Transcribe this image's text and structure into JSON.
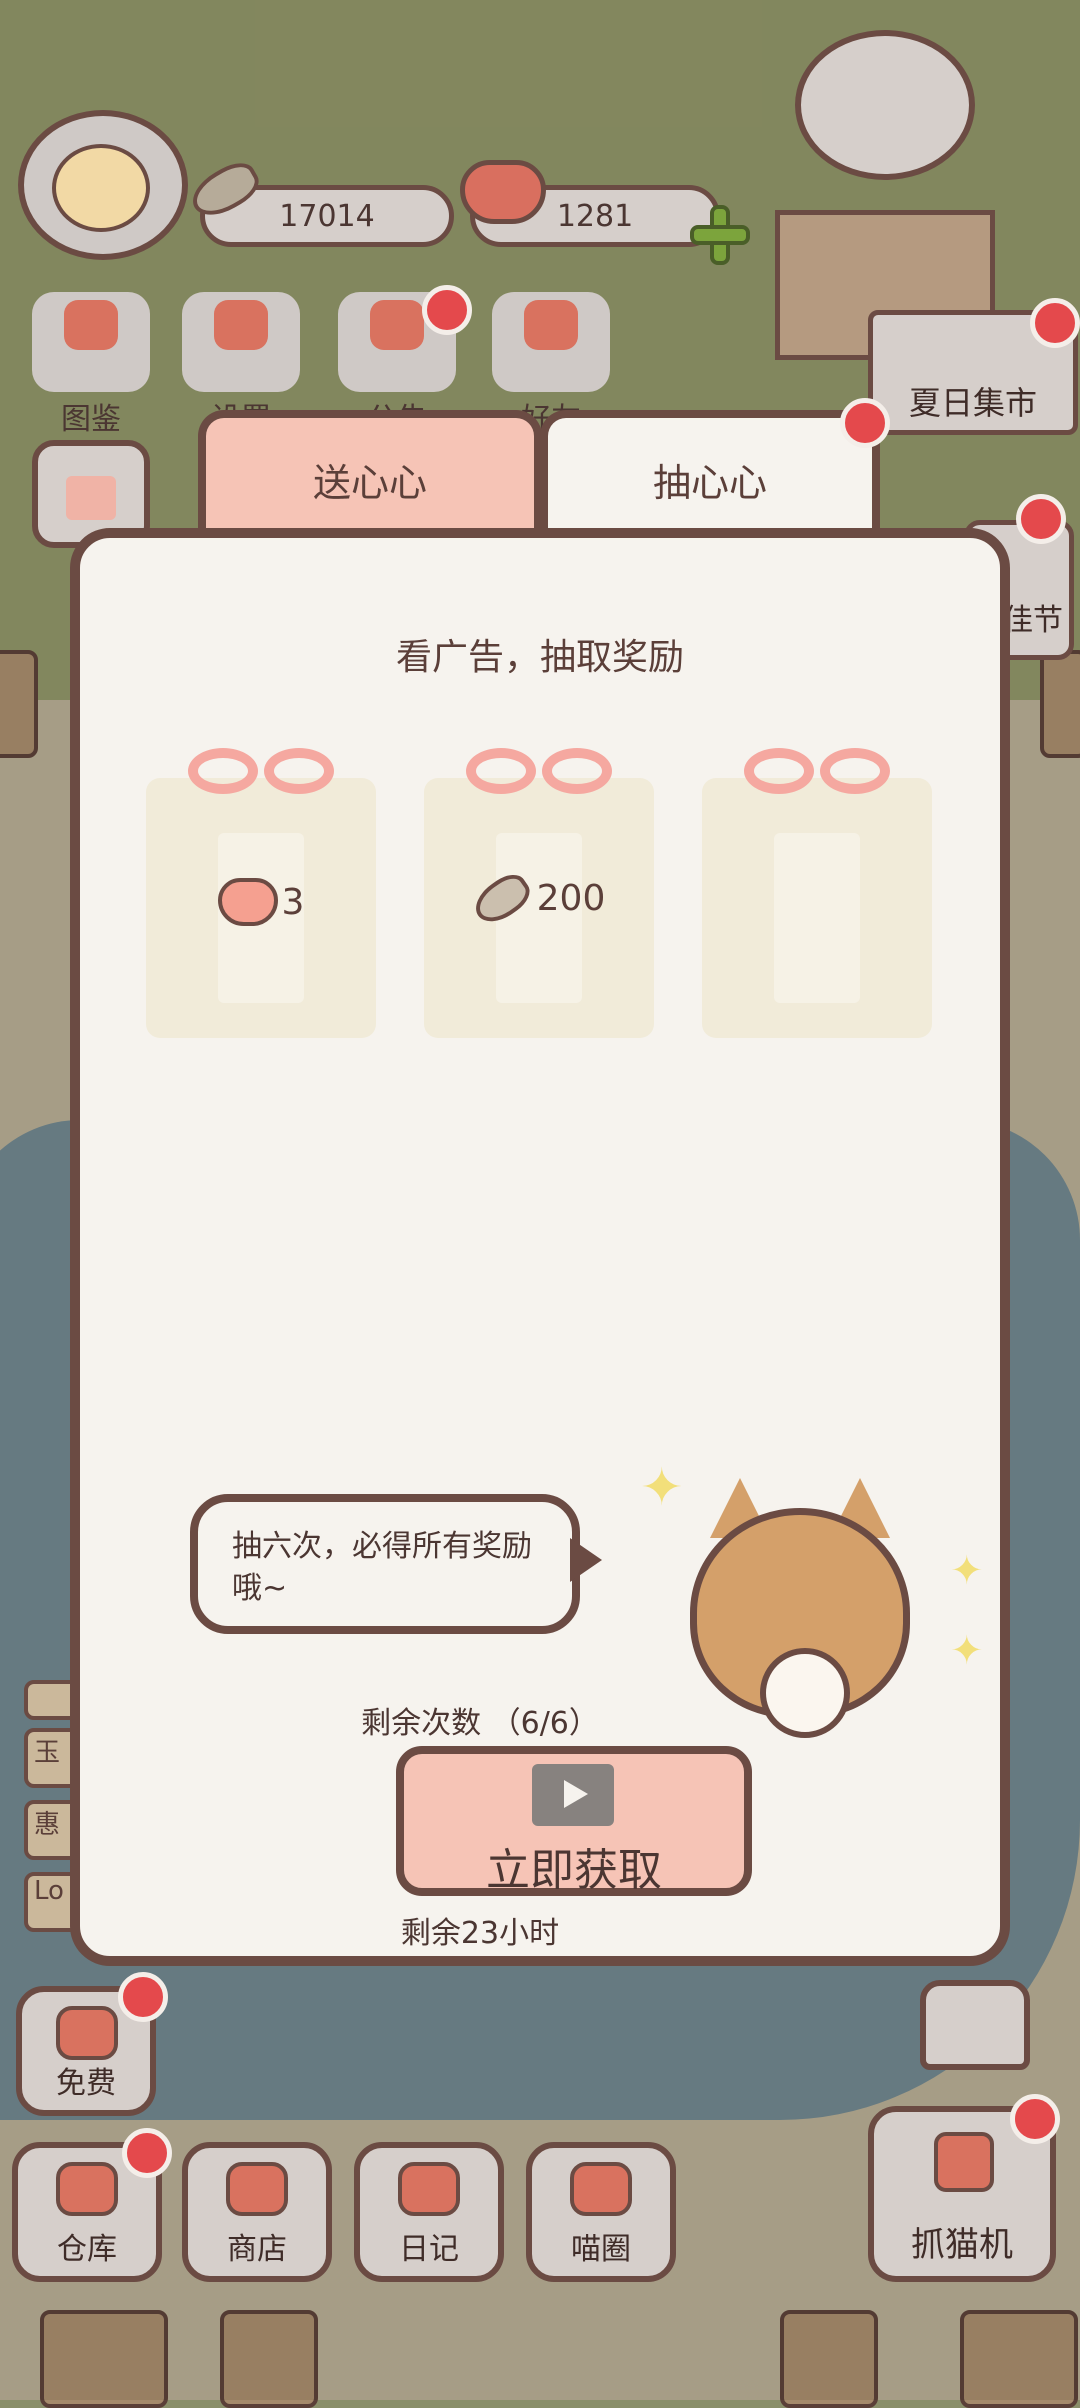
{
  "hud": {
    "fish_count": "17014",
    "heart_count": "1281"
  },
  "menu": {
    "items": [
      {
        "label": "图鉴"
      },
      {
        "label": "设置"
      },
      {
        "label": "公告"
      },
      {
        "label": "好友"
      }
    ]
  },
  "event": {
    "market_label": "夏日集市",
    "side_label": "佳节"
  },
  "side_tags": [
    "玉",
    "惠",
    "Lo"
  ],
  "dialog": {
    "tabs": [
      {
        "label": "送心心"
      },
      {
        "label": "抽心心"
      }
    ],
    "subtitle": "看广告，抽取奖励",
    "rewards": [
      {
        "icon": "heart-icon",
        "amount": "3"
      },
      {
        "icon": "fish-icon",
        "amount": "200"
      },
      {
        "icon": "",
        "amount": ""
      }
    ],
    "speech": "抽六次，必得所有奖励哦~",
    "remaining_label": "剩余次数 （6/6）",
    "get_button": "立即获取",
    "timer_label": "剩余23小时"
  },
  "bottom_nav": {
    "free_label": "免费",
    "items": [
      {
        "label": "仓库"
      },
      {
        "label": "商店"
      },
      {
        "label": "日记"
      },
      {
        "label": "喵圈"
      }
    ],
    "claw_label": "抓猫机"
  },
  "colors": {
    "outline": "#6b4b43",
    "panel": "#f6f3ee",
    "accent_pink": "#f6c4b6",
    "notification_red": "#e4494c"
  }
}
